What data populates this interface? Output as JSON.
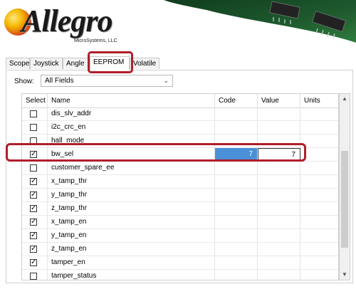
{
  "banner": {
    "logo_text": "Allegro",
    "logo_subtext": "MicroSystems, LLC"
  },
  "tabs": [
    {
      "label": "Scope"
    },
    {
      "label": "Joystick"
    },
    {
      "label": "Angle"
    },
    {
      "label": "EEPROM"
    },
    {
      "label": "Volatile"
    }
  ],
  "active_tab": "EEPROM",
  "show": {
    "label": "Show:",
    "value": "All Fields"
  },
  "table": {
    "columns": [
      "Select",
      "Name",
      "Code",
      "Value",
      "Units"
    ],
    "rows": [
      {
        "checked": false,
        "name": "dis_slv_addr",
        "code": "",
        "value": "",
        "units": ""
      },
      {
        "checked": false,
        "name": "i2c_crc_en",
        "code": "",
        "value": "",
        "units": ""
      },
      {
        "checked": false,
        "name": "hall_mode",
        "code": "",
        "value": "",
        "units": ""
      },
      {
        "checked": true,
        "name": "bw_sel",
        "code": "7",
        "value": "7",
        "units": ""
      },
      {
        "checked": false,
        "name": "customer_spare_ee",
        "code": "",
        "value": "",
        "units": ""
      },
      {
        "checked": true,
        "name": "x_tamp_thr",
        "code": "",
        "value": "",
        "units": ""
      },
      {
        "checked": true,
        "name": "y_tamp_thr",
        "code": "",
        "value": "",
        "units": ""
      },
      {
        "checked": true,
        "name": "z_tamp_thr",
        "code": "",
        "value": "",
        "units": ""
      },
      {
        "checked": true,
        "name": "x_tamp_en",
        "code": "",
        "value": "",
        "units": ""
      },
      {
        "checked": true,
        "name": "y_tamp_en",
        "code": "",
        "value": "",
        "units": ""
      },
      {
        "checked": true,
        "name": "z_tamp_en",
        "code": "",
        "value": "",
        "units": ""
      },
      {
        "checked": true,
        "name": "tamper_en",
        "code": "",
        "value": "",
        "units": ""
      },
      {
        "checked": false,
        "name": "tamper_status",
        "code": "",
        "value": "",
        "units": ""
      }
    ]
  },
  "colors": {
    "highlight_frame": "#b01e2a",
    "selected_cell": "#4a90d9",
    "banner_green": "#1f5a2e"
  }
}
